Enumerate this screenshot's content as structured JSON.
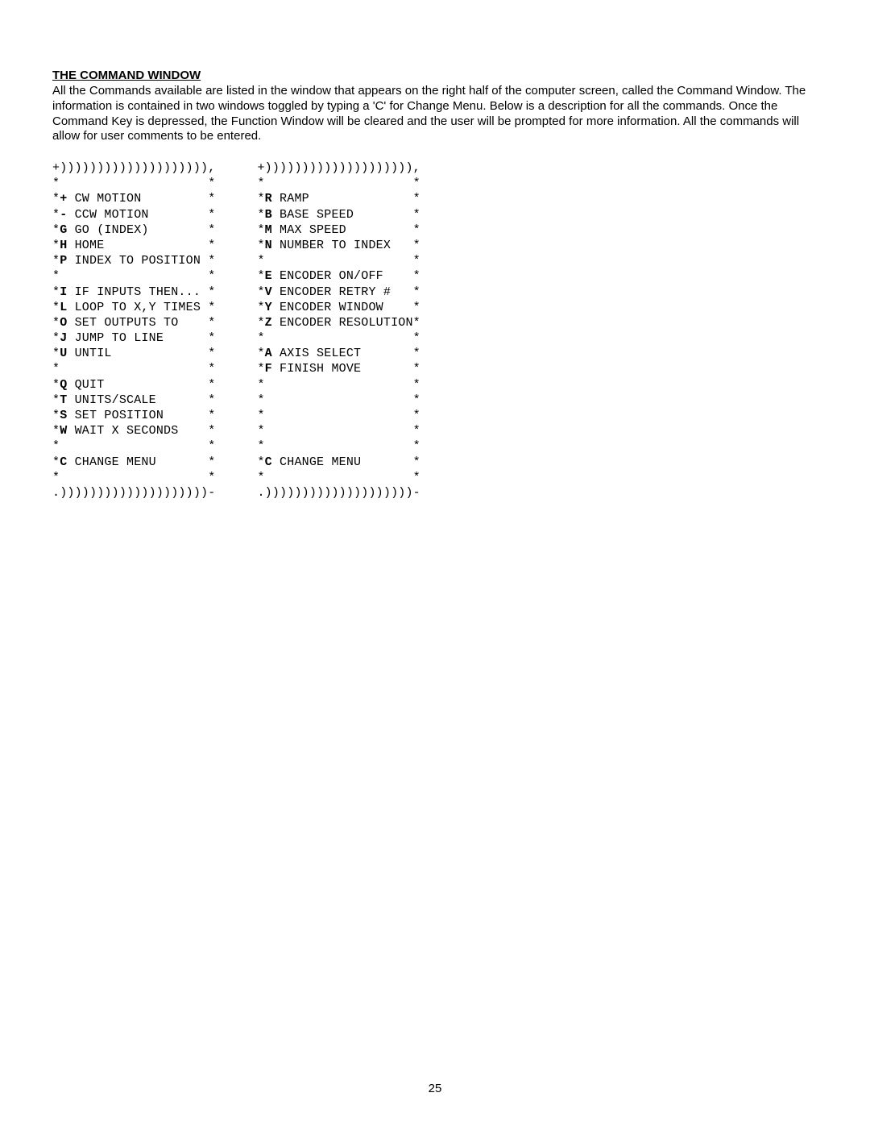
{
  "heading": "THE COMMAND WINDOW",
  "paragraph": "All the Commands available are listed in the window that appears on the right half of the computer screen, called the Command Window.  The information is contained in two windows toggled by typing a 'C' for Change Menu.  Below is a description for all the commands.  Once the Command Key is depressed, the Function Window will be cleared and the user will be prompted for more information.  All the commands will allow for user comments to be entered.",
  "borderTop": "+)))))))))))))))))))),",
  "borderBot": ".))))))))))))))))))))-",
  "menuLeft": [
    {
      "key": "",
      "label": ""
    },
    {
      "key": "+",
      "label": "CW MOTION"
    },
    {
      "key": "-",
      "label": "CCW MOTION"
    },
    {
      "key": "G",
      "label": "GO (INDEX)"
    },
    {
      "key": "H",
      "label": "HOME"
    },
    {
      "key": "P",
      "label": "INDEX TO POSITION"
    },
    {
      "key": "",
      "label": ""
    },
    {
      "key": "I",
      "label": "IF INPUTS THEN..."
    },
    {
      "key": "L",
      "label": "LOOP TO X,Y TIMES"
    },
    {
      "key": "O",
      "label": "SET OUTPUTS TO"
    },
    {
      "key": "J",
      "label": "JUMP TO LINE"
    },
    {
      "key": "U",
      "label": "UNTIL"
    },
    {
      "key": "",
      "label": ""
    },
    {
      "key": "Q",
      "label": "QUIT"
    },
    {
      "key": "T",
      "label": "UNITS/SCALE"
    },
    {
      "key": "S",
      "label": "SET POSITION"
    },
    {
      "key": "W",
      "label": "WAIT X SECONDS"
    },
    {
      "key": "",
      "label": ""
    },
    {
      "key": "C",
      "label": "CHANGE MENU"
    },
    {
      "key": "",
      "label": ""
    }
  ],
  "menuRight": [
    {
      "key": "",
      "label": ""
    },
    {
      "key": "R",
      "label": "RAMP"
    },
    {
      "key": "B",
      "label": "BASE SPEED"
    },
    {
      "key": "M",
      "label": "MAX SPEED"
    },
    {
      "key": "N",
      "label": "NUMBER TO INDEX"
    },
    {
      "key": "",
      "label": ""
    },
    {
      "key": "E",
      "label": "ENCODER ON/OFF"
    },
    {
      "key": "V",
      "label": "ENCODER RETRY #"
    },
    {
      "key": "Y",
      "label": "ENCODER WINDOW"
    },
    {
      "key": "Z",
      "label": "ENCODER RESOLUTION"
    },
    {
      "key": "",
      "label": ""
    },
    {
      "key": "A",
      "label": "AXIS SELECT"
    },
    {
      "key": "F",
      "label": "FINISH MOVE"
    },
    {
      "key": "",
      "label": ""
    },
    {
      "key": "",
      "label": ""
    },
    {
      "key": "",
      "label": ""
    },
    {
      "key": "",
      "label": ""
    },
    {
      "key": "",
      "label": ""
    },
    {
      "key": "C",
      "label": "CHANGE MENU"
    },
    {
      "key": "",
      "label": ""
    }
  ],
  "pageNumber": "25"
}
